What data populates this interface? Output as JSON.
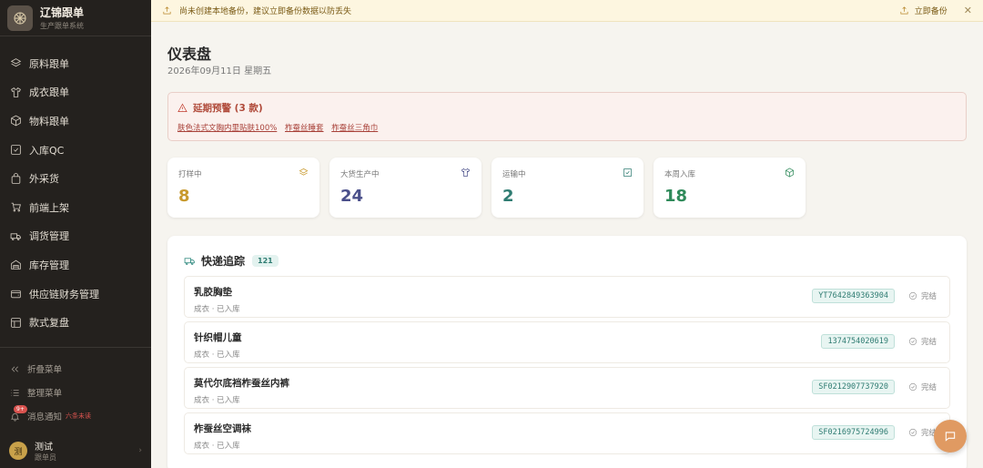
{
  "brand": {
    "title": "辽锦跟单",
    "subtitle": "生产跟单系统"
  },
  "nav": [
    {
      "label": "原料跟单",
      "icon": "layers-icon"
    },
    {
      "label": "成衣跟单",
      "icon": "shirt-icon"
    },
    {
      "label": "物料跟单",
      "icon": "box-icon"
    },
    {
      "label": "入库QC",
      "icon": "check-square-icon"
    },
    {
      "label": "外采货",
      "icon": "bag-icon"
    },
    {
      "label": "前端上架",
      "icon": "cart-icon"
    },
    {
      "label": "调货管理",
      "icon": "truck-icon"
    },
    {
      "label": "库存管理",
      "icon": "warehouse-icon"
    },
    {
      "label": "供应链财务管理",
      "icon": "wallet-icon"
    },
    {
      "label": "款式复盘",
      "icon": "grid-icon"
    }
  ],
  "sidebar_bottom": {
    "collapse_label": "折叠菜单",
    "organize_label": "整理菜单",
    "notify_label": "消息通知",
    "notify_badge": "9+",
    "notify_extra": "六条未读",
    "user_initial": "测",
    "user_name": "测试",
    "user_role": "跟单员"
  },
  "banner": {
    "message": "尚未创建本地备份，建议立即备份数据以防丢失",
    "backup_label": "立即备份",
    "close_glyph": "✕"
  },
  "page": {
    "title": "仪表盘",
    "date": "2026年09月11日 星期五"
  },
  "alert": {
    "title": "延期预警 (3 款)",
    "links": [
      "肤色法式文胸内里贴肤100%",
      "柞蚕丝睡套",
      "柞蚕丝三角巾"
    ]
  },
  "stats": [
    {
      "label": "打样中",
      "value": "8",
      "color": "#c89a2e",
      "icon": "layers-icon"
    },
    {
      "label": "大货生产中",
      "value": "24",
      "color": "#4a4f8a",
      "icon": "shirt-icon"
    },
    {
      "label": "运输中",
      "value": "2",
      "color": "#2f7c72",
      "icon": "check-square-icon"
    },
    {
      "label": "本周入库",
      "value": "18",
      "color": "#2f8a5a",
      "icon": "box-icon"
    }
  ],
  "tracking": {
    "title": "快递追踪",
    "count": "121",
    "rows": [
      {
        "name": "乳胶胸垫",
        "sub": "成衣 · 已入库",
        "code": "YT7642849363904",
        "status": "完结"
      },
      {
        "name": "针织帽儿童",
        "sub": "成衣 · 已入库",
        "code": "1374754020619",
        "status": "完结"
      },
      {
        "name": "莫代尔底裆柞蚕丝内裤",
        "sub": "成衣 · 已入库",
        "code": "SF0212907737920",
        "status": "完结"
      },
      {
        "name": "柞蚕丝空调袜",
        "sub": "成衣 · 已入库",
        "code": "SF0216975724996",
        "status": "完结"
      }
    ]
  }
}
